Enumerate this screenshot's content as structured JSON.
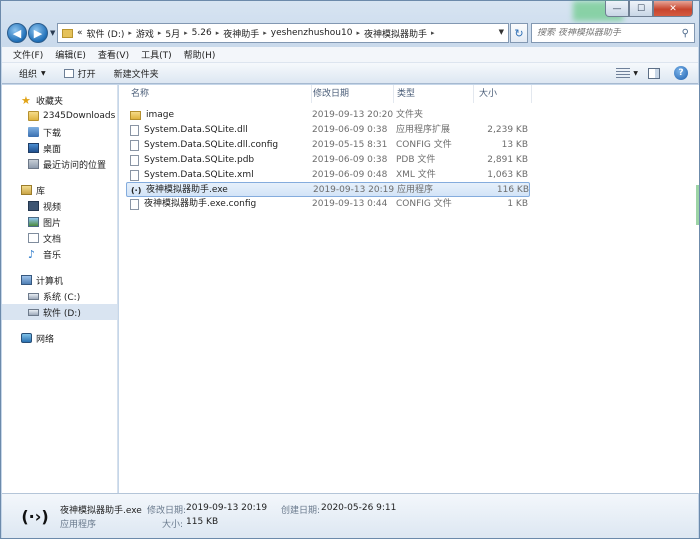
{
  "window": {
    "caption_min": "—",
    "caption_max": "☐",
    "caption_close": "✕"
  },
  "address": {
    "overflow": "«",
    "crumbs": [
      "软件 (D:)",
      "游戏",
      "5月",
      "5.26",
      "夜神助手",
      "yeshenzhushou10",
      "夜神模拟器助手"
    ],
    "separator": "▸"
  },
  "search": {
    "placeholder": "搜索 夜神模拟器助手"
  },
  "menu": [
    "文件(F)",
    "编辑(E)",
    "查看(V)",
    "工具(T)",
    "帮助(H)"
  ],
  "toolbar": {
    "organize": "组织",
    "open": "打开",
    "new_folder": "新建文件夹"
  },
  "nav": {
    "favorites": "收藏夹",
    "fav_items": [
      "2345Downloads",
      "下载",
      "桌面",
      "最近访问的位置"
    ],
    "libraries": "库",
    "lib_items": [
      "视频",
      "图片",
      "文档",
      "音乐"
    ],
    "computer": "计算机",
    "drives": [
      "系统 (C:)",
      "软件 (D:)"
    ],
    "network": "网络"
  },
  "columns": {
    "name": "名称",
    "date": "修改日期",
    "type": "类型",
    "size": "大小"
  },
  "files": [
    {
      "name": "image",
      "date": "2019-09-13 20:20",
      "type": "文件夹",
      "size": "",
      "kind": "folder"
    },
    {
      "name": "System.Data.SQLite.dll",
      "date": "2019-06-09 0:38",
      "type": "应用程序扩展",
      "size": "2,239 KB",
      "kind": "file"
    },
    {
      "name": "System.Data.SQLite.dll.config",
      "date": "2019-05-15 8:31",
      "type": "CONFIG 文件",
      "size": "13 KB",
      "kind": "file"
    },
    {
      "name": "System.Data.SQLite.pdb",
      "date": "2019-06-09 0:38",
      "type": "PDB 文件",
      "size": "2,891 KB",
      "kind": "file"
    },
    {
      "name": "System.Data.SQLite.xml",
      "date": "2019-06-09 0:48",
      "type": "XML 文件",
      "size": "1,063 KB",
      "kind": "file"
    },
    {
      "name": "夜神模拟器助手.exe",
      "date": "2019-09-13 20:19",
      "type": "应用程序",
      "size": "116 KB",
      "kind": "exe"
    },
    {
      "name": "夜神模拟器助手.exe.config",
      "date": "2019-09-13 0:44",
      "type": "CONFIG 文件",
      "size": "1 KB",
      "kind": "file"
    }
  ],
  "details": {
    "icon_glyph": "(·›)",
    "name": "夜神模拟器助手.exe",
    "kind": "应用程序",
    "modified_label": "修改日期:",
    "modified_value": "2019-09-13 20:19",
    "created_label": "创建日期:",
    "created_value": "2020-05-26 9:11",
    "size_label": "大小:",
    "size_value": "115 KB"
  }
}
